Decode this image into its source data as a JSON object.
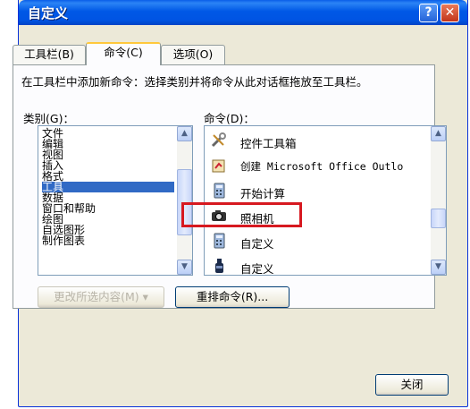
{
  "window": {
    "title": "自定义"
  },
  "titlebar_buttons": {
    "help": "?",
    "close": "✕"
  },
  "tabs": [
    {
      "label": "工具栏(B)",
      "active": false
    },
    {
      "label": "命令(C)",
      "active": true
    },
    {
      "label": "选项(O)",
      "active": false
    }
  ],
  "description": "在工具栏中添加新命令：选择类别并将命令从此对话框拖放至工具栏。",
  "categories": {
    "label": "类别(G)：",
    "items": [
      "文件",
      "编辑",
      "视图",
      "插入",
      "格式",
      "工具",
      "数据",
      "窗口和帮助",
      "绘图",
      "自选图形",
      "制作图表"
    ],
    "selected": "工具"
  },
  "commands": {
    "label": "命令(D)：",
    "items": [
      {
        "label": "控件工具箱",
        "icon": "tools-icon"
      },
      {
        "label": "创建 Microsoft Office Outlo",
        "icon": "outlook-icon"
      },
      {
        "label": "开始计算",
        "icon": "calculator-icon"
      },
      {
        "label": "照相机",
        "icon": "camera-icon"
      },
      {
        "label": "自定义",
        "icon": "calculator-icon"
      },
      {
        "label": "自定义",
        "icon": "bottle-icon"
      }
    ],
    "highlighted": "照相机"
  },
  "buttons": {
    "modify_selection": "更改所选内容(M)",
    "rearrange": "重排命令(R)...",
    "close": "关闭"
  },
  "colors": {
    "title_bar": "#0054e3",
    "selection": "#316ac5",
    "highlight_box": "#d71920"
  }
}
